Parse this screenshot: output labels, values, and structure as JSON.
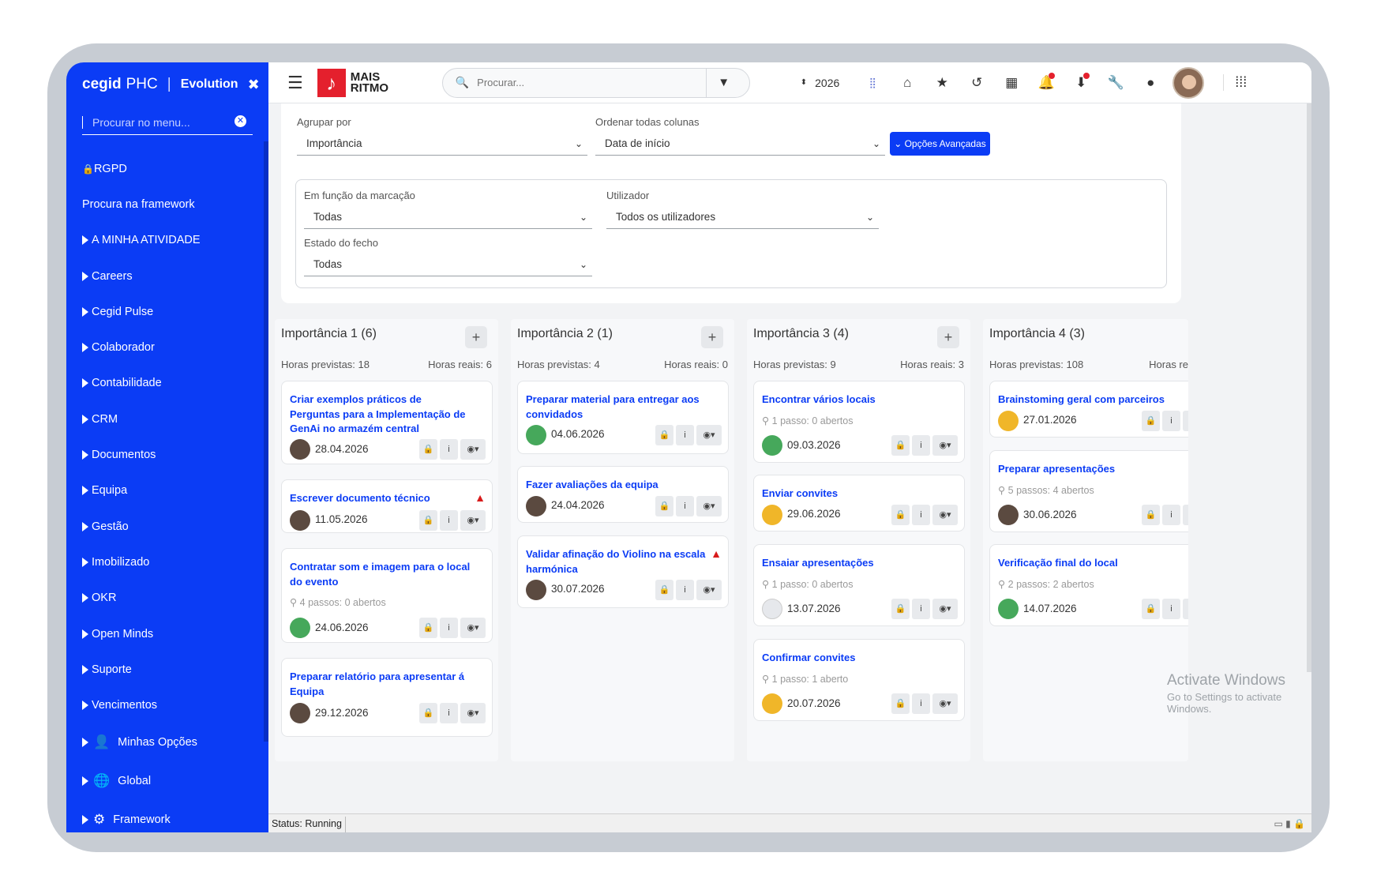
{
  "brand": {
    "name": "cegid",
    "product": "PHC",
    "edition": "Evolution",
    "close_icon": "✖"
  },
  "sidebar": {
    "search_placeholder": "Procurar no menu...",
    "items": [
      {
        "label": "RGPD",
        "icon": "lock-icon",
        "glyph": "🔒"
      },
      {
        "label": "Procura na framework"
      },
      {
        "label": "A MINHA ATIVIDADE",
        "expandable": true
      },
      {
        "label": "Careers",
        "expandable": true
      },
      {
        "label": "Cegid Pulse",
        "expandable": true
      },
      {
        "label": "Colaborador",
        "expandable": true
      },
      {
        "label": "Contabilidade",
        "expandable": true
      },
      {
        "label": "CRM",
        "expandable": true
      },
      {
        "label": "Documentos",
        "expandable": true
      },
      {
        "label": "Equipa",
        "expandable": true
      },
      {
        "label": "Gestão",
        "expandable": true
      },
      {
        "label": "Imobilizado",
        "expandable": true
      },
      {
        "label": "OKR",
        "expandable": true
      },
      {
        "label": "Open Minds",
        "expandable": true
      },
      {
        "label": "Suporte",
        "expandable": true
      },
      {
        "label": "Vencimentos",
        "expandable": true
      },
      {
        "label": "Minhas Opções",
        "expandable": true,
        "icon": "user-icon",
        "glyph": "👤"
      },
      {
        "label": "Global",
        "expandable": true,
        "icon": "globe-icon",
        "glyph": "🌐"
      },
      {
        "label": "Framework",
        "expandable": true,
        "icon": "gears-icon",
        "glyph": "⚙"
      }
    ]
  },
  "topbar": {
    "logo_text": "MAIS RITMO",
    "search_placeholder": "Procurar...",
    "year": "2026",
    "accent_color": "#0b3cf5",
    "logo_color": "#e4202d"
  },
  "filters": {
    "group_by_label": "Agrupar por",
    "group_by_value": "Importância",
    "order_label": "Ordenar todas colunas",
    "order_value": "Data de início",
    "advanced_button": "Opções Avançadas",
    "marking_label": "Em função da marcação",
    "marking_value": "Todas",
    "user_label": "Utilizador",
    "user_value": "Todos os utilizadores",
    "close_state_label": "Estado do fecho",
    "close_state_value": "Todas"
  },
  "columns": [
    {
      "title": "Importância 1 (6)",
      "hours_planned": "Horas previstas: 18",
      "hours_real": "Horas reais: 6",
      "tasks": [
        {
          "title": "Criar exemplos práticos de Perguntas para a Implementação de GenAi no armazém central",
          "date": "28.04.2026"
        },
        {
          "title": "Escrever documento técnico",
          "date": "11.05.2026",
          "warning": true
        },
        {
          "title": "Contratar som e imagem para o local do evento",
          "steps": "4 passos: 0 abertos",
          "date": "24.06.2026"
        },
        {
          "title": "Preparar relatório para apresentar á Equipa",
          "date": "29.12.2026"
        }
      ]
    },
    {
      "title": "Importância 2 (1)",
      "hours_planned": "Horas previstas: 4",
      "hours_real": "Horas reais: 0",
      "tasks": [
        {
          "title": "Preparar material para entregar aos convidados",
          "date": "04.06.2026"
        },
        {
          "title": "Fazer avaliações da equipa",
          "date": "24.04.2026"
        },
        {
          "title": "Validar afinação do Violino na escala harmónica",
          "date": "30.07.2026",
          "warning": true
        }
      ]
    },
    {
      "title": "Importância 3 (4)",
      "hours_planned": "Horas previstas: 9",
      "hours_real": "Horas reais: 3",
      "tasks": [
        {
          "title": "Encontrar vários locais",
          "steps": "1 passo: 0 abertos",
          "date": "09.03.2026"
        },
        {
          "title": "Enviar convites",
          "date": "29.06.2026"
        },
        {
          "title": "Ensaiar apresentações",
          "steps": "1 passo: 0 abertos",
          "date": "13.07.2026"
        },
        {
          "title": "Confirmar convites",
          "steps": "1 passo: 1 aberto",
          "date": "20.07.2026"
        }
      ]
    },
    {
      "title": "Importância 4 (3)",
      "hours_planned": "Horas previstas: 108",
      "hours_real": "Horas re",
      "tasks": [
        {
          "title": "Brainstoming geral com parceiros",
          "date": "27.01.2026"
        },
        {
          "title": "Preparar apresentações",
          "steps": "5 passos: 4 abertos",
          "date": "30.06.2026"
        },
        {
          "title": "Verificação final do local",
          "steps": "2 passos: 2 abertos",
          "date": "14.07.2026"
        }
      ]
    }
  ],
  "status": {
    "text": "Status: Running"
  },
  "watermark": {
    "line1": "Activate Windows",
    "line2": "Go to Settings to activate Windows."
  }
}
